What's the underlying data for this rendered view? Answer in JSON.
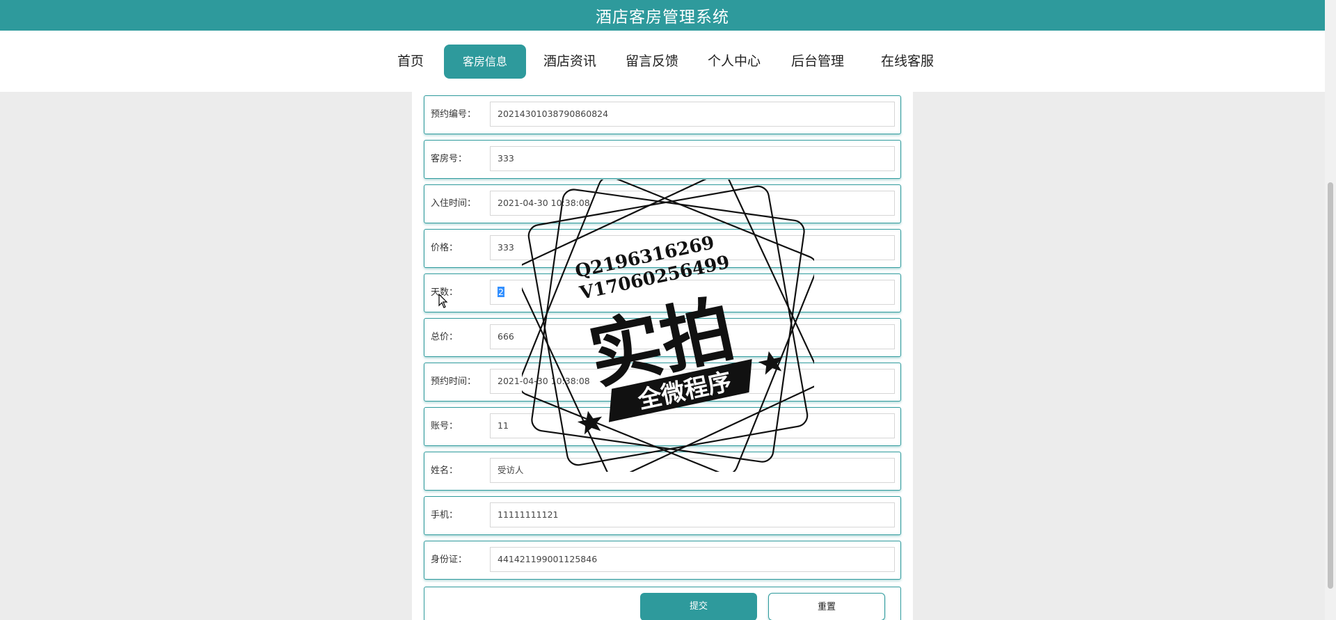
{
  "header": {
    "title": "酒店客房管理系统"
  },
  "nav": {
    "items": [
      {
        "label": "首页",
        "active": false
      },
      {
        "label": "客房信息",
        "active": true
      },
      {
        "label": "酒店资讯",
        "active": false
      },
      {
        "label": "留言反馈",
        "active": false
      },
      {
        "label": "个人中心",
        "active": false
      },
      {
        "label": "后台管理",
        "active": false
      },
      {
        "label": "在线客服",
        "active": false
      }
    ]
  },
  "form": {
    "fields": [
      {
        "label": "预约编号：",
        "value": "20214301038790860824"
      },
      {
        "label": "客房号：",
        "value": "333"
      },
      {
        "label": "入住时间：",
        "value": "2021-04-30 10:38:08"
      },
      {
        "label": "价格：",
        "value": "333"
      },
      {
        "label": "天数：",
        "value": "2",
        "selected": true
      },
      {
        "label": "总价：",
        "value": "666"
      },
      {
        "label": "预约时间：",
        "value": "2021-04-30 10:38:08"
      },
      {
        "label": "账号：",
        "value": "11"
      },
      {
        "label": "姓名：",
        "value": "受访人"
      },
      {
        "label": "手机：",
        "value": "11111111121"
      },
      {
        "label": "身份证：",
        "value": "441421199001125846"
      }
    ],
    "submit_label": "提交",
    "reset_label": "重置"
  },
  "watermark": {
    "contact_q": "Q2196316269",
    "contact_v": "V17060256499",
    "main_text": "实拍",
    "banner_text": "全微程序"
  },
  "colors": {
    "accent": "#2e9a9c",
    "page_bg": "#ececec",
    "selection": "#3390ff"
  }
}
